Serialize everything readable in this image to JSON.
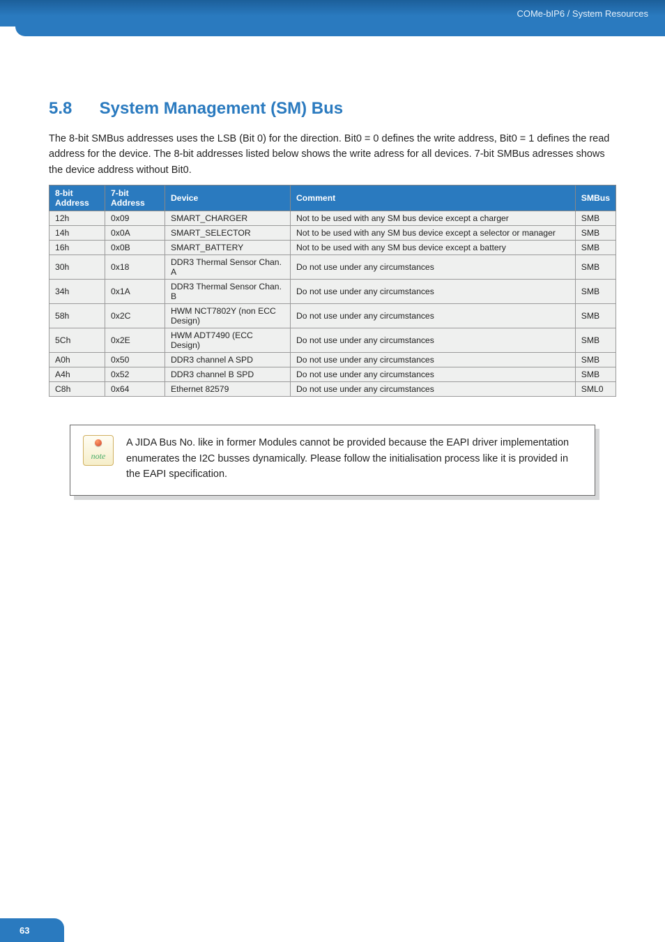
{
  "header": {
    "breadcrumb": "COMe-bIP6 / System Resources"
  },
  "section": {
    "number": "5.8",
    "title": "System Management (SM) Bus",
    "paragraph": "The 8-bit SMBus addresses uses the LSB (Bit 0) for the direction. Bit0 = 0 defines the write address, Bit0 = 1 defines the read address for the device. The 8-bit addresses listed below shows the write adress for all devices. 7-bit SMBus adresses shows the device address without Bit0."
  },
  "table": {
    "headers": {
      "addr8": "8-bit Address",
      "addr7": "7-bit Address",
      "device": "Device",
      "comment": "Comment",
      "smbus": "SMBus"
    },
    "rows": [
      {
        "addr8": "12h",
        "addr7": "0x09",
        "device": "SMART_CHARGER",
        "comment": "Not to be used with any SM bus device except a charger",
        "smbus": "SMB"
      },
      {
        "addr8": "14h",
        "addr7": "0x0A",
        "device": "SMART_SELECTOR",
        "comment": "Not to be used with any SM bus device except a selector or manager",
        "smbus": "SMB"
      },
      {
        "addr8": "16h",
        "addr7": "0x0B",
        "device": "SMART_BATTERY",
        "comment": "Not to be used with any SM bus device except a battery",
        "smbus": "SMB"
      },
      {
        "addr8": "30h",
        "addr7": "0x18",
        "device": "DDR3 Thermal Sensor Chan. A",
        "comment": "Do not use under any circumstances",
        "smbus": "SMB"
      },
      {
        "addr8": "34h",
        "addr7": "0x1A",
        "device": "DDR3 Thermal Sensor Chan. B",
        "comment": "Do not use under any circumstances",
        "smbus": "SMB"
      },
      {
        "addr8": "58h",
        "addr7": "0x2C",
        "device": "HWM NCT7802Y (non ECC Design)",
        "comment": "Do not use under any circumstances",
        "smbus": "SMB"
      },
      {
        "addr8": "5Ch",
        "addr7": "0x2E",
        "device": "HWM ADT7490 (ECC Design)",
        "comment": "Do not use under any circumstances",
        "smbus": "SMB"
      },
      {
        "addr8": "A0h",
        "addr7": "0x50",
        "device": "DDR3 channel A SPD",
        "comment": "Do not use under any circumstances",
        "smbus": "SMB"
      },
      {
        "addr8": "A4h",
        "addr7": "0x52",
        "device": "DDR3 channel B SPD",
        "comment": "Do not use under any circumstances",
        "smbus": "SMB"
      },
      {
        "addr8": "C8h",
        "addr7": "0x64",
        "device": "Ethernet 82579",
        "comment": "Do not use under any circumstances",
        "smbus": "SML0"
      }
    ]
  },
  "note": {
    "icon_label": "note",
    "text": "A JIDA Bus No. like in former Modules cannot be provided because the EAPI driver implementation enumerates the I2C busses dynamically. Please follow the initialisation process like it is provided in the EAPI specification."
  },
  "footer": {
    "page_number": "63"
  }
}
